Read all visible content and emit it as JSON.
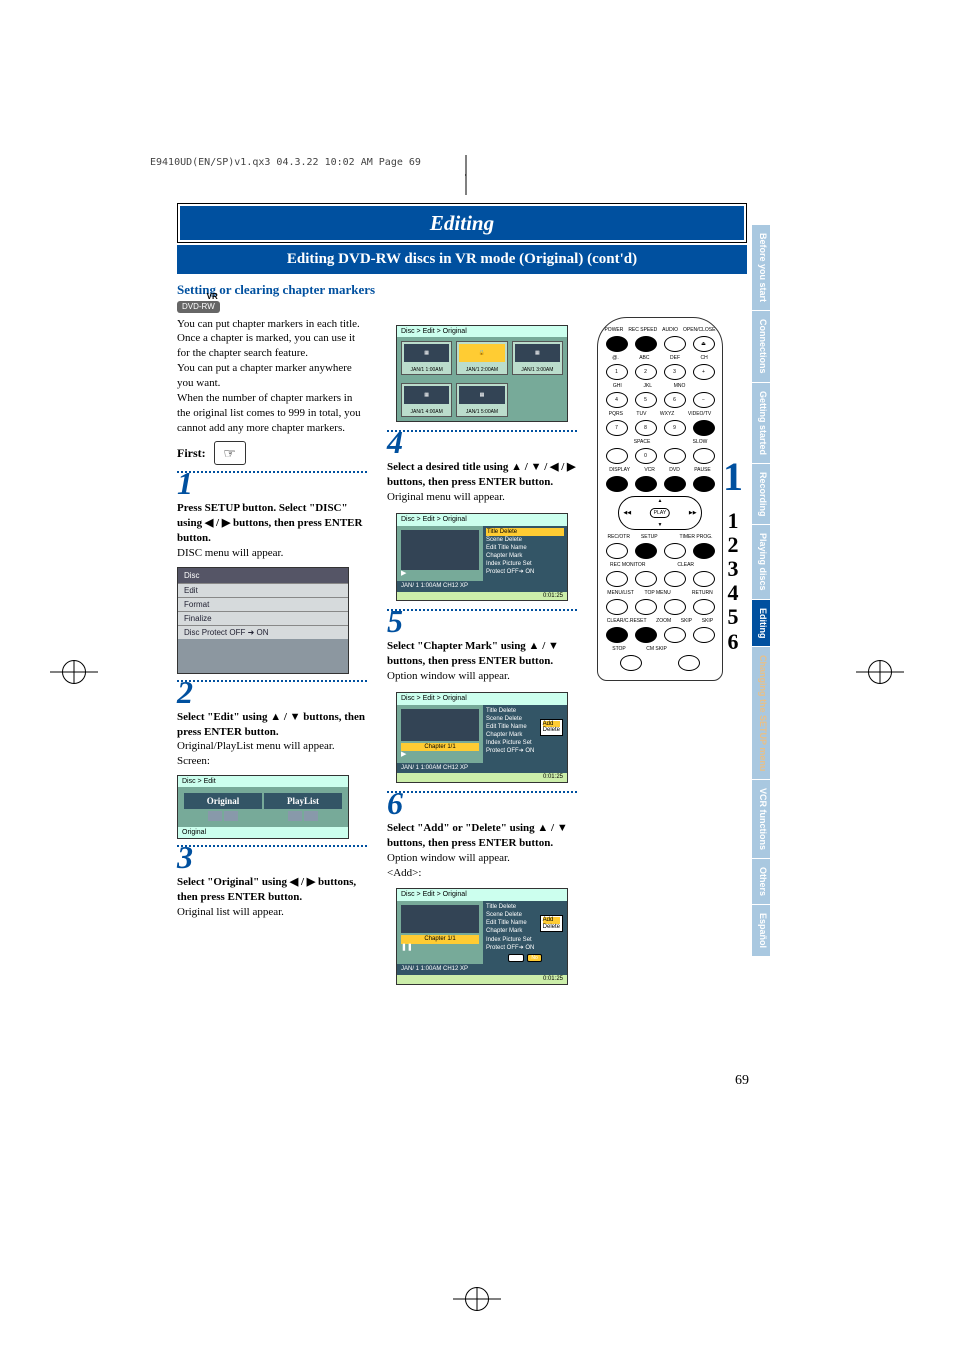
{
  "header_line": "E9410UD(EN/SP)v1.qx3  04.3.22  10:02 AM  Page 69",
  "title": "Editing",
  "subtitle": "Editing DVD-RW discs in VR mode (Original) (cont'd)",
  "section_heading": "Setting or clearing chapter markers",
  "badge": "DVD-RW",
  "intro_body": "You can put chapter markers in each title. Once a chapter is marked, you can use it for the chapter search feature.\nYou can put a chapter marker anywhere you want.\nWhen the number of chapter markers in the original list comes to 999 in total, you cannot add any more chapter markers.",
  "first_label": "First:",
  "steps": {
    "1": {
      "head": "Press SETUP button. Select \"DISC\" using ◀ / ▶ buttons, then press ENTER button.",
      "body": "DISC menu will appear."
    },
    "2": {
      "head": "Select \"Edit\" using ▲ / ▼ buttons, then press ENTER button.",
      "body": "Original/PlayList menu will appear.\n    Screen:"
    },
    "3": {
      "head": "Select \"Original\" using ◀ / ▶ buttons, then press ENTER button.",
      "body": "Original list will appear."
    },
    "4": {
      "head": "Select a desired title using ▲ / ▼ / ◀ / ▶ buttons, then press ENTER button.",
      "body": "Original menu will appear."
    },
    "5": {
      "head": "Select \"Chapter Mark\" using ▲ / ▼ buttons, then press ENTER button.",
      "body": "Option window will appear."
    },
    "6": {
      "head": "Select \"Add\" or \"Delete\" using ▲ / ▼ buttons, then press ENTER button.",
      "body": "Option window will appear.\n    <Add>:"
    }
  },
  "discmenu": {
    "title": "Disc",
    "items": [
      "Edit",
      "Format",
      "Finalize",
      "Disc Protect OFF ➜ ON"
    ]
  },
  "dual": {
    "crumbs": "Disc > Edit",
    "left": "Original",
    "right": "PlayList",
    "footer": "Original"
  },
  "panel4": {
    "crumbs": "Disc > Edit > Original",
    "thumbs": [
      "JAN/1  1:00AM",
      "JAN/1  2:00AM",
      "JAN/1  3:00AM",
      "JAN/1  4:00AM",
      "JAN/1  5:00AM"
    ]
  },
  "panel4b": {
    "crumbs": "Disc > Edit > Original",
    "menu": [
      "Title Delete",
      "Scene Delete",
      "Edit Title Name",
      "Chapter Mark",
      "Index Picture Set",
      "Protect OFF➜ ON"
    ],
    "ftr_left": "JAN/ 1  1:00AM  CH12    XP",
    "ftr_right": "0:01:25"
  },
  "panel5": {
    "crumbs": "Disc > Edit > Original",
    "chapter": "Chapter 1/1",
    "menu": [
      "Title Delete",
      "Scene Delete",
      "Edit Title Name",
      "Chapter Mark",
      "Index Picture Set",
      "Protect OFF➜ ON"
    ],
    "popup": [
      "Add",
      "Delete"
    ],
    "ftr_left": "JAN/ 1  1:00AM  CH12    XP",
    "ftr_right": "0:01:25"
  },
  "panel6": {
    "crumbs": "Disc > Edit > Original",
    "chapter": "Chapter 1/1",
    "menu": [
      "Title Delete",
      "Scene Delete",
      "Edit Title Name",
      "Chapter Mark",
      "Index Picture Set",
      "Protect OFF➜ ON"
    ],
    "popup": [
      "Add",
      "Delete"
    ],
    "yes": "Yes",
    "no": "No",
    "ftr_left": "JAN/ 1  1:00AM  CH12    XP",
    "ftr_right": "0:01:25"
  },
  "remote": {
    "rows": [
      [
        "POWER",
        "REC SPEED",
        "AUDIO",
        "OPEN/CLOSE"
      ],
      [
        "@.",
        "ABC",
        "DEF",
        "CH"
      ],
      [
        "1",
        "2",
        "3",
        "+"
      ],
      [
        "GHI",
        "JKL",
        "MNO",
        "CH"
      ],
      [
        "4",
        "5",
        "6",
        "−"
      ],
      [
        "PQRS",
        "TUV",
        "WXYZ",
        "VIDEO/TV"
      ],
      [
        "7",
        "8",
        "9",
        ""
      ],
      [
        "",
        "SPACE",
        "",
        "SLOW"
      ],
      [
        "",
        "0",
        "",
        ""
      ],
      [
        "DISPLAY",
        "VCR",
        "DVD",
        "PAUSE"
      ],
      [
        "REC/OTR",
        "SETUP",
        "",
        "TIMER PROG."
      ],
      [
        "",
        "",
        "CLEAR",
        ""
      ],
      [
        "REC MONITOR",
        "",
        "",
        ""
      ],
      [
        "MENU/LIST",
        "TOP MENU",
        "",
        "RETURN"
      ],
      [
        "CLEAR/C.RESET",
        "ZOOM",
        "SKIP",
        "SKIP"
      ],
      [
        "STOP",
        "CM SKIP",
        "",
        ""
      ]
    ],
    "nav_labels": [
      "REV",
      "PLAY",
      "FWD",
      "STOP"
    ]
  },
  "big_one": "1",
  "vert_steps": [
    "1",
    "2",
    "3",
    "4",
    "5",
    "6"
  ],
  "sidetabs": [
    "Before you start",
    "Connections",
    "Getting started",
    "Recording",
    "Playing discs",
    "Editing",
    "Changing the SETUP menu",
    "VCR functions",
    "Others",
    "Español"
  ],
  "active_tab_index": 5,
  "pagenum": "69"
}
